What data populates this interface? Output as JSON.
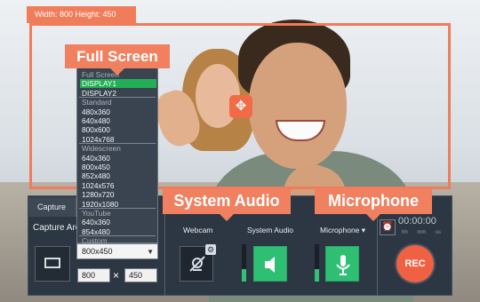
{
  "capture_frame": {
    "dimensions_text": "Width: 800  Height: 450"
  },
  "callouts": {
    "full_screen": "Full Screen",
    "system_audio": "System Audio",
    "microphone": "Microphone"
  },
  "capture_panel": {
    "tab_label": "Capture",
    "area_label": "Capture Area",
    "width_value": "800",
    "times_symbol": "×",
    "height_value": "450"
  },
  "area_dropdown": {
    "items": [
      {
        "label": "Full Screen",
        "kind": "header"
      },
      {
        "label": "DISPLAY1",
        "kind": "item",
        "selected": true
      },
      {
        "label": "DISPLAY2",
        "kind": "item"
      },
      {
        "label": "Standard",
        "kind": "header"
      },
      {
        "label": "480x360",
        "kind": "item"
      },
      {
        "label": "640x480",
        "kind": "item"
      },
      {
        "label": "800x600",
        "kind": "item"
      },
      {
        "label": "1024x768",
        "kind": "item"
      },
      {
        "label": "Widescreen",
        "kind": "header"
      },
      {
        "label": "640x360",
        "kind": "item"
      },
      {
        "label": "800x450",
        "kind": "item"
      },
      {
        "label": "852x480",
        "kind": "item"
      },
      {
        "label": "1024x576",
        "kind": "item"
      },
      {
        "label": "1280x720",
        "kind": "item"
      },
      {
        "label": "1920x1080",
        "kind": "item"
      },
      {
        "label": "YouTube",
        "kind": "header"
      },
      {
        "label": "640x360",
        "kind": "item"
      },
      {
        "label": "854x480",
        "kind": "item"
      },
      {
        "label": "Custom",
        "kind": "header"
      }
    ],
    "selected_value": "800x450"
  },
  "audio": {
    "webcam_label": "Webcam",
    "system_audio_label": "System Audio",
    "microphone_label": "Microphone ▾"
  },
  "recording": {
    "timer": "00:00:00",
    "timer_units": [
      "hh",
      "mm",
      "ss"
    ],
    "rec_label": "REC"
  },
  "colors": {
    "accent": "#f07c5a",
    "panel": "#2d3643",
    "active_green": "#2ebf73",
    "selected_green": "#23af55",
    "rec_red": "#f06143"
  },
  "icons": {
    "move": "move-icon",
    "capture_area": "capture-area-icon",
    "webcam_disabled": "webcam-disabled-icon",
    "speaker": "speaker-icon",
    "microphone": "microphone-icon",
    "timer": "alarm-clock-icon",
    "settings": "gear-icon"
  }
}
